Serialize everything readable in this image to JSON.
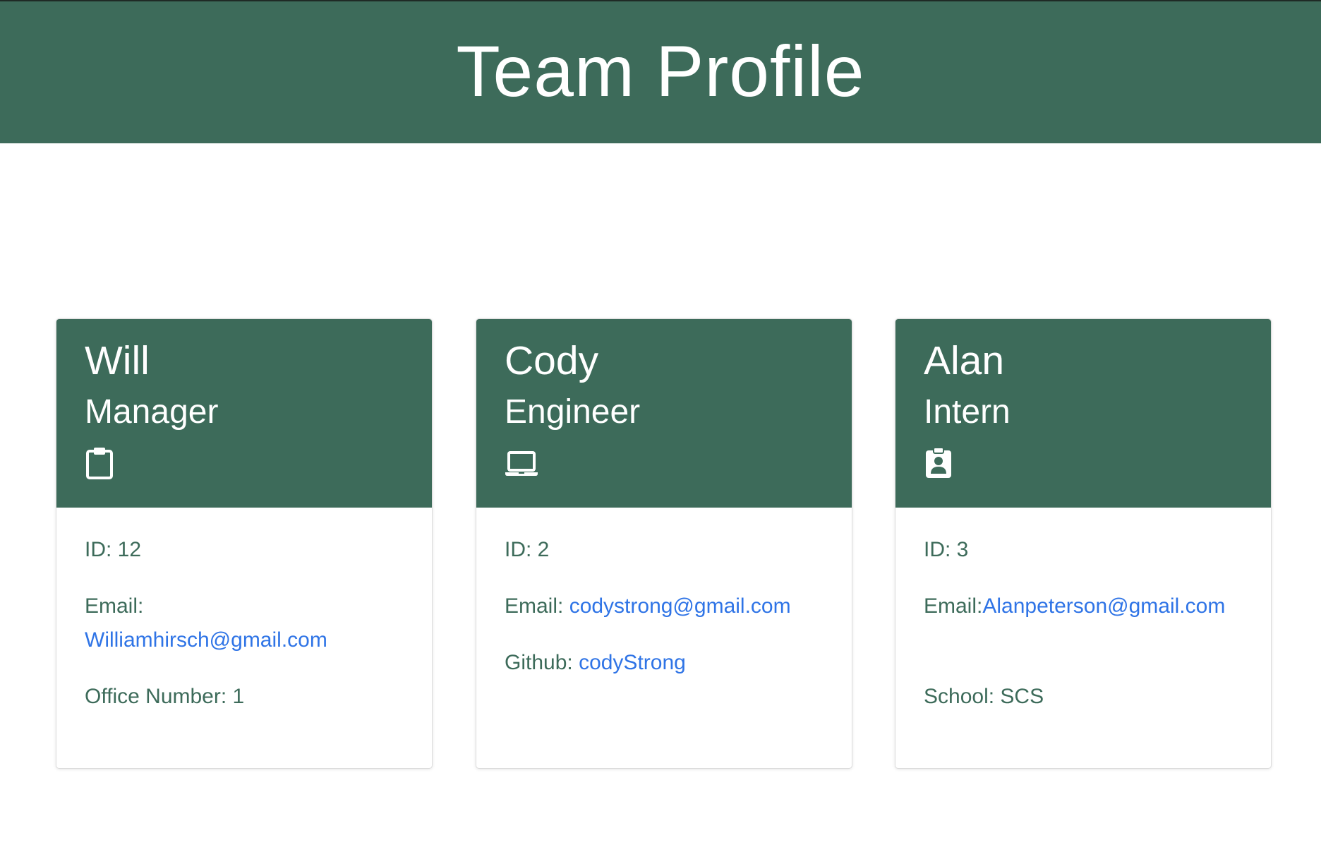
{
  "page": {
    "title": "Team Profile"
  },
  "colors": {
    "header_bg": "#3d6b5a",
    "text_green": "#3d6b5a",
    "link_blue": "#2f74e6"
  },
  "employees": [
    {
      "name": "Will",
      "role": "Manager",
      "icon": "clipboard-icon",
      "id_label": "ID: 12",
      "email_label": "Email:",
      "email": "Williamhirsch@gmail.com",
      "extra_label": "Office Number: 1"
    },
    {
      "name": "Cody",
      "role": "Engineer",
      "icon": "laptop-icon",
      "id_label": "ID: 2",
      "email_label": "Email: ",
      "email": "codystrong@gmail.com",
      "extra_label": "Github: ",
      "extra_value": "codyStrong"
    },
    {
      "name": "Alan",
      "role": "Intern",
      "icon": "id-badge-icon",
      "id_label": "ID: 3",
      "email_label": "Email:",
      "email": "Alanpeterson@gmail.com",
      "extra_label": "School: SCS"
    }
  ]
}
